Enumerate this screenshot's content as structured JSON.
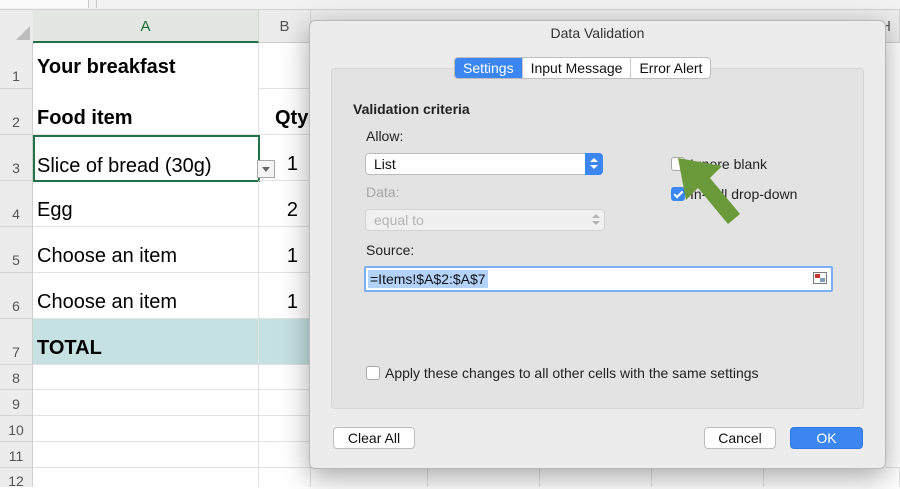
{
  "sheet": {
    "columns": [
      {
        "label": "A",
        "selected": true
      },
      {
        "label": "B",
        "selected": false
      },
      {
        "label": "H",
        "selected": false
      }
    ],
    "rows": [
      {
        "num": "1",
        "a": "Your breakfast",
        "b": "",
        "bold": true
      },
      {
        "num": "2",
        "a": "Food item",
        "b": "Qty",
        "bold": true
      },
      {
        "num": "3",
        "a": "Slice of bread (30g)",
        "b": "1",
        "bold": false
      },
      {
        "num": "4",
        "a": "Egg",
        "b": "2",
        "bold": false
      },
      {
        "num": "5",
        "a": "Choose an item",
        "b": "1",
        "bold": false
      },
      {
        "num": "6",
        "a": "Choose an item",
        "b": "1",
        "bold": false
      },
      {
        "num": "7",
        "a": "TOTAL",
        "b": "",
        "bold": true
      },
      {
        "num": "8",
        "a": "",
        "b": ""
      },
      {
        "num": "9",
        "a": "",
        "b": ""
      },
      {
        "num": "10",
        "a": "",
        "b": ""
      },
      {
        "num": "11",
        "a": "",
        "b": ""
      },
      {
        "num": "12",
        "a": "",
        "b": ""
      }
    ],
    "total_row_color": "#c5e1e1",
    "accent_color": "#217346"
  },
  "dialog": {
    "title": "Data Validation",
    "tabs": [
      {
        "label": "Settings",
        "active": true
      },
      {
        "label": "Input Message",
        "active": false
      },
      {
        "label": "Error Alert",
        "active": false
      }
    ],
    "criteria_heading": "Validation criteria",
    "allow_label": "Allow:",
    "allow_value": "List",
    "data_label": "Data:",
    "data_value": "equal to",
    "ignore_blank_label": "Ignore blank",
    "ignore_blank_checked": false,
    "in_cell_dropdown_label": "In-cell drop-down",
    "in_cell_dropdown_checked": true,
    "source_label": "Source:",
    "source_value": "=Items!$A$2:$A$7",
    "apply_label": "Apply these changes to all other cells with the same settings",
    "apply_checked": false,
    "clear_all_label": "Clear All",
    "cancel_label": "Cancel",
    "ok_label": "OK",
    "accent_color": "#3b86f1"
  },
  "annotation": {
    "icon": "green-arrow-icon",
    "color": "#6b9a3a"
  }
}
